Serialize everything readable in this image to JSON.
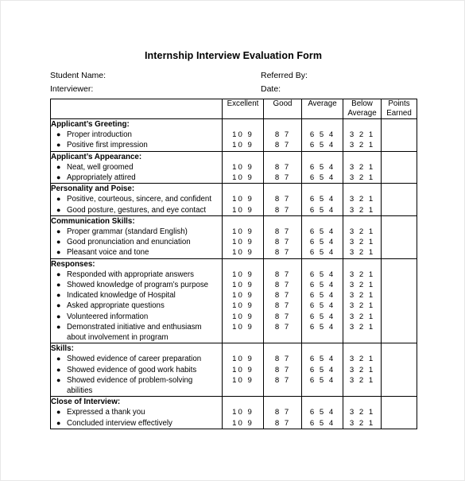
{
  "document": {
    "title": "Internship Interview Evaluation Form"
  },
  "meta": {
    "student_name_label": "Student Name:",
    "referred_by_label": "Referred By:",
    "interviewer_label": "Interviewer:",
    "date_label": "Date:",
    "student_name_value": "",
    "referred_by_value": "",
    "interviewer_value": "",
    "date_value": ""
  },
  "table": {
    "headers": {
      "item": "",
      "excellent": "Excellent",
      "good": "Good",
      "average": "Average",
      "below_average": "Below Average",
      "points_earned": "Points Earned"
    },
    "scales": {
      "excellent": "10  9",
      "good": "8  7",
      "average": "6  5  4",
      "below_average": "3  2  1"
    },
    "bullet_glyph": "●",
    "sections": [
      {
        "title": "Applicant’s  Greeting:",
        "items": [
          {
            "text": "Proper introduction"
          },
          {
            "text": "Positive first impression"
          }
        ]
      },
      {
        "title": "Applicant’s Appearance:",
        "items": [
          {
            "text": "Neat, well groomed"
          },
          {
            "text": "Appropriately attired"
          }
        ]
      },
      {
        "title": "Personality and Poise:",
        "items": [
          {
            "text": "Positive, courteous, sincere, and confident"
          },
          {
            "text": "Good posture, gestures, and eye contact"
          }
        ]
      },
      {
        "title": "Communication Skills:",
        "items": [
          {
            "text": "Proper grammar (standard English)"
          },
          {
            "text": "Good pronunciation and enunciation"
          },
          {
            "text": "Pleasant voice and tone"
          }
        ]
      },
      {
        "title": "Responses:",
        "items": [
          {
            "text": "Responded with appropriate answers"
          },
          {
            "text": "Showed knowledge of program’s purpose"
          },
          {
            "text": "Indicated knowledge of Hospital"
          },
          {
            "text": "Asked appropriate questions"
          },
          {
            "text": "Volunteered information"
          },
          {
            "text": "Demonstrated initiative and enthusiasm",
            "continuation": "about involvement in program"
          }
        ]
      },
      {
        "title": "Skills:",
        "items": [
          {
            "text": "Showed evidence of career preparation"
          },
          {
            "text": "Showed evidence of good work habits"
          },
          {
            "text": "Showed evidence of problem-solving",
            "continuation": "abilities"
          }
        ]
      },
      {
        "title": "Close of Interview:",
        "items": [
          {
            "text": "Expressed a thank you"
          },
          {
            "text": "Concluded interview effectively"
          }
        ]
      }
    ]
  },
  "colors": {
    "text": "#000000",
    "border": "#000000",
    "background": "#ffffff"
  }
}
